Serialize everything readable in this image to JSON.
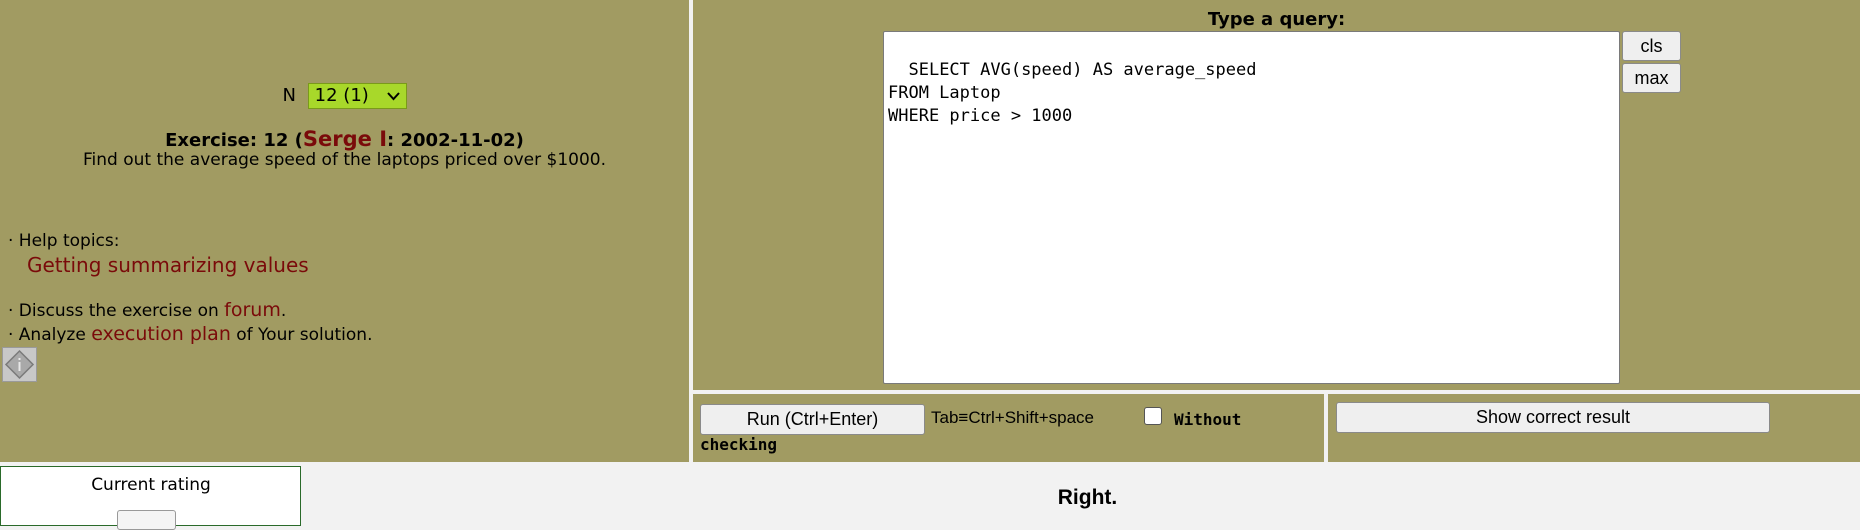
{
  "exercise": {
    "n_label": "N",
    "n_selected": "12 (1)",
    "title_prefix": "Exercise: 12 (",
    "author": "Serge I",
    "title_suffix": ": 2002-11-02)",
    "text": "Find out the average speed of the laptops priced over $1000."
  },
  "help": {
    "label": "· Help topics:",
    "link": "Getting summarizing values"
  },
  "discuss": {
    "prefix": "· Discuss the exercise on ",
    "link": "forum",
    "suffix": "."
  },
  "analyze": {
    "prefix": "· Analyze ",
    "link": "execution plan",
    "suffix": " of Your solution."
  },
  "query": {
    "label": "Type a query:",
    "text": "SELECT AVG(speed) AS average_speed\nFROM Laptop\nWHERE price > 1000"
  },
  "buttons": {
    "cls": "cls",
    "max": "max",
    "run": "Run (Ctrl+Enter)",
    "show_result": "Show correct result"
  },
  "run_bar": {
    "tab_hint": "Tab≡Ctrl+Shift+space",
    "without_line1": "Without",
    "without_line2": "checking",
    "without_checked": false
  },
  "rating": {
    "label": "Current rating"
  },
  "result_message": "Right.",
  "colors": {
    "panel_bg": "#a19b62",
    "link": "#7a0a0a",
    "select_bg": "#a8d82a",
    "page_bg": "#f2f2f2"
  },
  "icons": {
    "info": "info-diamond-icon",
    "dropdown": "chevron-down-icon",
    "resize": "resize-grip-icon"
  }
}
